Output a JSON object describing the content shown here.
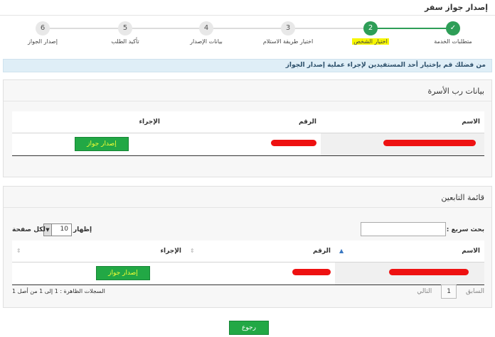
{
  "page": {
    "title": "إصدار جواز سفر"
  },
  "stepper": {
    "steps": [
      {
        "number": "",
        "label": "متطلبات الخدمة",
        "state": "done"
      },
      {
        "number": "2",
        "label": "اختيار الشخص",
        "state": "active"
      },
      {
        "number": "3",
        "label": "اختيار طريقة الاستلام",
        "state": "pending"
      },
      {
        "number": "4",
        "label": "بيانات الإصدار",
        "state": "pending"
      },
      {
        "number": "5",
        "label": "تأكيد الطلب",
        "state": "pending"
      },
      {
        "number": "6",
        "label": "إصدار الجواز",
        "state": "pending"
      }
    ]
  },
  "info": {
    "message": "من فضلك قم بإختيار أحد المستفيدين لإجراء عملية إصدار الجواز"
  },
  "family_head": {
    "title": "بيانات رب الأسرة",
    "columns": {
      "name": "الاسم",
      "number": "الرقم",
      "action": "الإجراء"
    },
    "row": {
      "action_label": "إصدار جواز"
    }
  },
  "dependents": {
    "title": "قائمة التابعين",
    "search_label": "بحث سريع :",
    "show_label": "إظهار",
    "page_size": "10",
    "per_page_label": "لكل صفحة",
    "columns": {
      "name": "الاسم",
      "number": "الرقم",
      "action": "الإجراء"
    },
    "row": {
      "action_label": "إصدار جواز"
    },
    "records_info": "السجلات الظاهرة : 1 إلى 1 من أصل 1",
    "pager": {
      "previous": "السابق",
      "current_page": "1",
      "next": "التالي"
    }
  },
  "footer": {
    "back_label": "رجوع"
  },
  "colors": {
    "green": "#22a845",
    "yellow_text": "#f4ff33",
    "info_bg": "#dfeef7",
    "redaction": "#ee1111"
  }
}
